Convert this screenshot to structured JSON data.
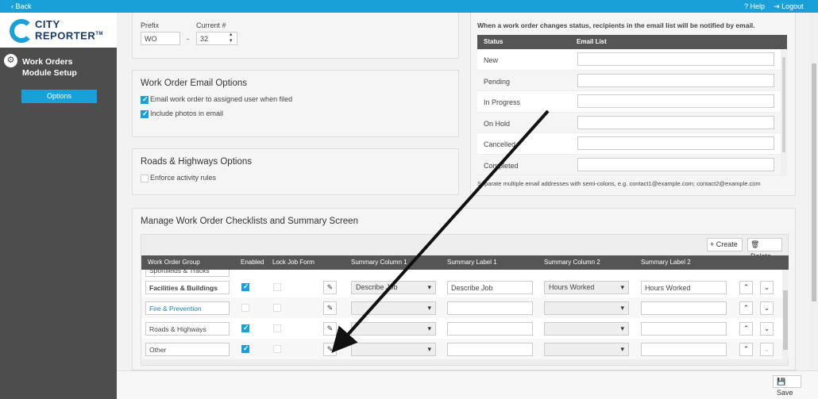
{
  "topbar": {
    "back": "Back",
    "help": "Help",
    "logout": "Logout"
  },
  "logo": {
    "line1": "CITY",
    "line2": "REPORTER",
    "tm": "TM"
  },
  "sidebar": {
    "module_title_1": "Work Orders",
    "module_title_2": "Module Setup",
    "options": "Options"
  },
  "prefix": {
    "prefix_label": "Prefix",
    "prefix_value": "WO",
    "dash": "-",
    "current_label": "Current #",
    "current_value": "32"
  },
  "email_options": {
    "title": "Work Order Email Options",
    "opt1": "Email work order to assigned user when filed",
    "opt2": "Include photos in email"
  },
  "roads": {
    "title": "Roads & Highways Options",
    "opt1": "Enforce activity rules"
  },
  "status_email": {
    "intro": "When a work order changes status, recipients in the email list will be notified by email.",
    "col_status": "Status",
    "col_email": "Email List",
    "rows": [
      "New",
      "Pending",
      "In Progress",
      "On Hold",
      "Cancelled",
      "Completed"
    ],
    "note": "Separate multiple email addresses with semi-colons, e.g. contact1@example.com; contact2@example.com"
  },
  "checklists": {
    "title": "Manage Work Order Checklists and Summary Screen",
    "create": "Create",
    "delete": "Delete",
    "headers": {
      "group": "Work Order Group",
      "enabled": "Enabled",
      "lock": "Lock Job Form",
      "sc1": "Summary Column 1",
      "sl1": "Summary Label 1",
      "sc2": "Summary Column 2",
      "sl2": "Summary Label 2"
    },
    "partial_row": "Sportfields & Tracks",
    "rows": [
      {
        "group": "Facilities & Buildings",
        "sc1": "Describe Job",
        "sl1": "Describe Job",
        "sc2": "Hours Worked",
        "sl2": "Hours Worked"
      },
      {
        "group": "Fire & Prevention",
        "sc1": "",
        "sl1": "",
        "sc2": "",
        "sl2": ""
      },
      {
        "group": "Roads & Highways",
        "sc1": "",
        "sl1": "",
        "sc2": "",
        "sl2": ""
      },
      {
        "group": "Other",
        "sc1": "",
        "sl1": "",
        "sc2": "",
        "sl2": ""
      }
    ]
  },
  "bottombar": {
    "save": "Save"
  }
}
